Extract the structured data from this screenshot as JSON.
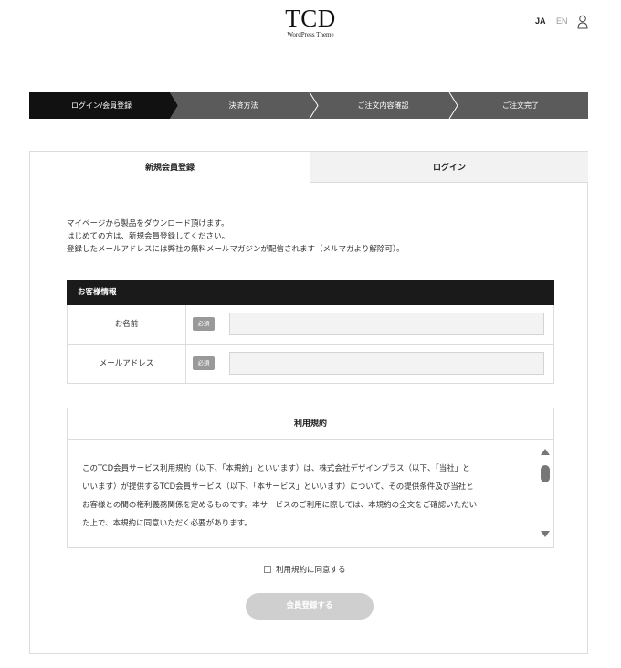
{
  "header": {
    "logo": "TCD",
    "logo_sub": "WordPress Theme",
    "lang_ja": "JA",
    "lang_en": "EN",
    "user_icon": "user-icon"
  },
  "steps": [
    {
      "label": "ログイン/会員登録",
      "active": true
    },
    {
      "label": "決済方法",
      "active": false
    },
    {
      "label": "ご注文内容確認",
      "active": false
    },
    {
      "label": "ご注文完了",
      "active": false
    }
  ],
  "colors": {
    "step_active": "#111111",
    "step_inactive": "#5b5b5b",
    "step_separator": "#ffffff",
    "info_header": "#1a1a1a",
    "required_badge": "#999999",
    "submit_disabled": "#cfcfcf"
  },
  "tabs": {
    "register": "新規会員登録",
    "login": "ログイン"
  },
  "intro": {
    "line1": "マイページから製品をダウンロード頂けます。",
    "line2": "はじめての方は、新規会員登録してください。",
    "line3": "登録したメールアドレスには弊社の無料メールマガジンが配信されます（メルマガより解除可）。"
  },
  "customer_info": {
    "title": "お客様情報",
    "required_label": "必須",
    "name_label": "お名前",
    "name_value": "",
    "email_label": "メールアドレス",
    "email_value": ""
  },
  "terms": {
    "title": "利用規約",
    "line1": "このTCD会員サービス利用規約（以下、「本規約」といいます）は、株式会社デザインプラス（以下、「当社」と",
    "line2": "いいます）が提供するTCD会員サービス（以下、「本サービス」といいます）について、その提供条件及び当社と",
    "line3": "お客様との間の権利義務関係を定めるものです。本サービスのご利用に際しては、本規約の全文をご確認いただい",
    "line4": "た上で、本規約に同意いただく必要があります。"
  },
  "agree": {
    "label": "利用規約に同意する",
    "checked": false
  },
  "submit": {
    "label": "会員登録する"
  }
}
